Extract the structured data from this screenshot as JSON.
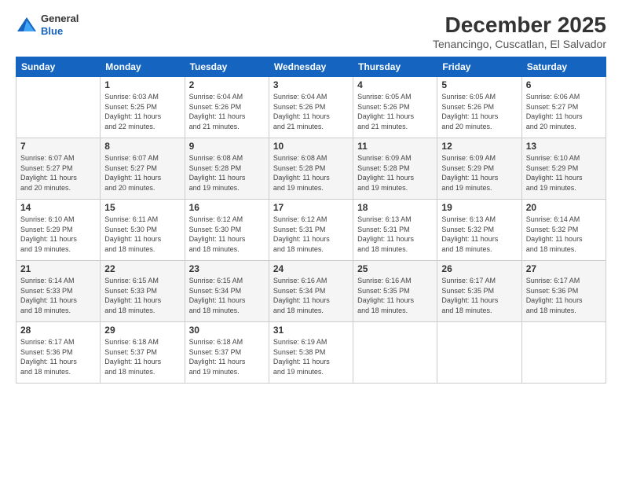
{
  "header": {
    "logo_line1": "General",
    "logo_line2": "Blue",
    "month": "December 2025",
    "location": "Tenancingo, Cuscatlan, El Salvador"
  },
  "weekdays": [
    "Sunday",
    "Monday",
    "Tuesday",
    "Wednesday",
    "Thursday",
    "Friday",
    "Saturday"
  ],
  "weeks": [
    [
      {
        "day": "",
        "info": ""
      },
      {
        "day": "1",
        "info": "Sunrise: 6:03 AM\nSunset: 5:25 PM\nDaylight: 11 hours\nand 22 minutes."
      },
      {
        "day": "2",
        "info": "Sunrise: 6:04 AM\nSunset: 5:26 PM\nDaylight: 11 hours\nand 21 minutes."
      },
      {
        "day": "3",
        "info": "Sunrise: 6:04 AM\nSunset: 5:26 PM\nDaylight: 11 hours\nand 21 minutes."
      },
      {
        "day": "4",
        "info": "Sunrise: 6:05 AM\nSunset: 5:26 PM\nDaylight: 11 hours\nand 21 minutes."
      },
      {
        "day": "5",
        "info": "Sunrise: 6:05 AM\nSunset: 5:26 PM\nDaylight: 11 hours\nand 20 minutes."
      },
      {
        "day": "6",
        "info": "Sunrise: 6:06 AM\nSunset: 5:27 PM\nDaylight: 11 hours\nand 20 minutes."
      }
    ],
    [
      {
        "day": "7",
        "info": "Sunrise: 6:07 AM\nSunset: 5:27 PM\nDaylight: 11 hours\nand 20 minutes."
      },
      {
        "day": "8",
        "info": "Sunrise: 6:07 AM\nSunset: 5:27 PM\nDaylight: 11 hours\nand 20 minutes."
      },
      {
        "day": "9",
        "info": "Sunrise: 6:08 AM\nSunset: 5:28 PM\nDaylight: 11 hours\nand 19 minutes."
      },
      {
        "day": "10",
        "info": "Sunrise: 6:08 AM\nSunset: 5:28 PM\nDaylight: 11 hours\nand 19 minutes."
      },
      {
        "day": "11",
        "info": "Sunrise: 6:09 AM\nSunset: 5:28 PM\nDaylight: 11 hours\nand 19 minutes."
      },
      {
        "day": "12",
        "info": "Sunrise: 6:09 AM\nSunset: 5:29 PM\nDaylight: 11 hours\nand 19 minutes."
      },
      {
        "day": "13",
        "info": "Sunrise: 6:10 AM\nSunset: 5:29 PM\nDaylight: 11 hours\nand 19 minutes."
      }
    ],
    [
      {
        "day": "14",
        "info": "Sunrise: 6:10 AM\nSunset: 5:29 PM\nDaylight: 11 hours\nand 19 minutes."
      },
      {
        "day": "15",
        "info": "Sunrise: 6:11 AM\nSunset: 5:30 PM\nDaylight: 11 hours\nand 18 minutes."
      },
      {
        "day": "16",
        "info": "Sunrise: 6:12 AM\nSunset: 5:30 PM\nDaylight: 11 hours\nand 18 minutes."
      },
      {
        "day": "17",
        "info": "Sunrise: 6:12 AM\nSunset: 5:31 PM\nDaylight: 11 hours\nand 18 minutes."
      },
      {
        "day": "18",
        "info": "Sunrise: 6:13 AM\nSunset: 5:31 PM\nDaylight: 11 hours\nand 18 minutes."
      },
      {
        "day": "19",
        "info": "Sunrise: 6:13 AM\nSunset: 5:32 PM\nDaylight: 11 hours\nand 18 minutes."
      },
      {
        "day": "20",
        "info": "Sunrise: 6:14 AM\nSunset: 5:32 PM\nDaylight: 11 hours\nand 18 minutes."
      }
    ],
    [
      {
        "day": "21",
        "info": "Sunrise: 6:14 AM\nSunset: 5:33 PM\nDaylight: 11 hours\nand 18 minutes."
      },
      {
        "day": "22",
        "info": "Sunrise: 6:15 AM\nSunset: 5:33 PM\nDaylight: 11 hours\nand 18 minutes."
      },
      {
        "day": "23",
        "info": "Sunrise: 6:15 AM\nSunset: 5:34 PM\nDaylight: 11 hours\nand 18 minutes."
      },
      {
        "day": "24",
        "info": "Sunrise: 6:16 AM\nSunset: 5:34 PM\nDaylight: 11 hours\nand 18 minutes."
      },
      {
        "day": "25",
        "info": "Sunrise: 6:16 AM\nSunset: 5:35 PM\nDaylight: 11 hours\nand 18 minutes."
      },
      {
        "day": "26",
        "info": "Sunrise: 6:17 AM\nSunset: 5:35 PM\nDaylight: 11 hours\nand 18 minutes."
      },
      {
        "day": "27",
        "info": "Sunrise: 6:17 AM\nSunset: 5:36 PM\nDaylight: 11 hours\nand 18 minutes."
      }
    ],
    [
      {
        "day": "28",
        "info": "Sunrise: 6:17 AM\nSunset: 5:36 PM\nDaylight: 11 hours\nand 18 minutes."
      },
      {
        "day": "29",
        "info": "Sunrise: 6:18 AM\nSunset: 5:37 PM\nDaylight: 11 hours\nand 18 minutes."
      },
      {
        "day": "30",
        "info": "Sunrise: 6:18 AM\nSunset: 5:37 PM\nDaylight: 11 hours\nand 19 minutes."
      },
      {
        "day": "31",
        "info": "Sunrise: 6:19 AM\nSunset: 5:38 PM\nDaylight: 11 hours\nand 19 minutes."
      },
      {
        "day": "",
        "info": ""
      },
      {
        "day": "",
        "info": ""
      },
      {
        "day": "",
        "info": ""
      }
    ]
  ]
}
